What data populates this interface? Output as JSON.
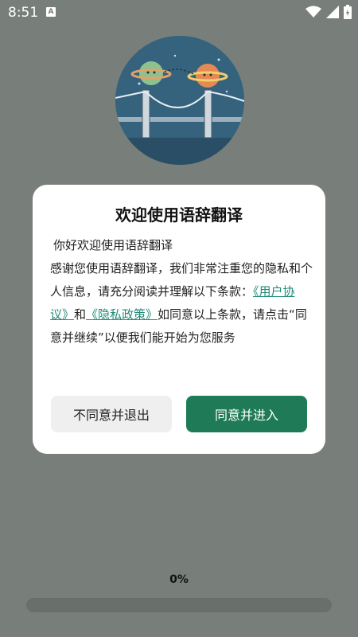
{
  "status_bar": {
    "time": "8:51",
    "notification_letter": "A"
  },
  "logo": {
    "icon": "planets-bridge-logo"
  },
  "dialog": {
    "title": "欢迎使用语辞翻译",
    "greeting": "你好欢迎使用语辞翻译",
    "body_part1": "感谢您使用语辞翻译，我们非常注重您的隐私和个人信息，请充分阅读并理解以下条款：",
    "user_agreement_link": "《用户协议》",
    "and_text": "和",
    "privacy_policy_link": "《隐私政策》",
    "body_part2": "如同意以上条款，请点击“同意并继续”以便我们能开始为您服务",
    "decline_button": "不同意并退出",
    "agree_button": "同意并进入"
  },
  "progress": {
    "label": "0%",
    "fraction": 0
  },
  "colors": {
    "overlay": "#787f7a",
    "accent": "#1e7a57",
    "link": "#1f8a78"
  }
}
